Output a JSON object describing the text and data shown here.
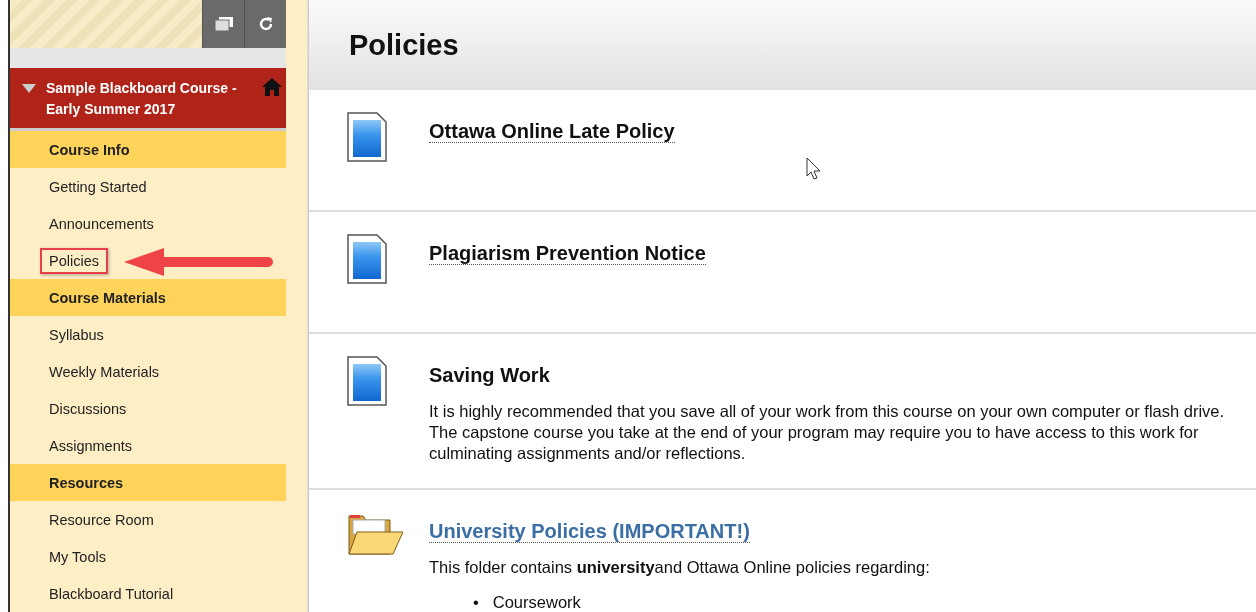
{
  "course": {
    "title": "Sample Blackboard Course - Early Summer 2017",
    "expanded": true
  },
  "menu": [
    {
      "kind": "header",
      "label": "Course Info",
      "highlighted": false
    },
    {
      "kind": "link",
      "label": "Getting Started",
      "highlighted": false
    },
    {
      "kind": "link",
      "label": "Announcements",
      "highlighted": false
    },
    {
      "kind": "link",
      "label": "Policies",
      "highlighted": true
    },
    {
      "kind": "header",
      "label": "Course Materials",
      "highlighted": false
    },
    {
      "kind": "link",
      "label": "Syllabus",
      "highlighted": false
    },
    {
      "kind": "link",
      "label": "Weekly Materials",
      "highlighted": false
    },
    {
      "kind": "link",
      "label": "Discussions",
      "highlighted": false
    },
    {
      "kind": "link",
      "label": "Assignments",
      "highlighted": false
    },
    {
      "kind": "header",
      "label": "Resources",
      "highlighted": false
    },
    {
      "kind": "link",
      "label": "Resource Room",
      "highlighted": false
    },
    {
      "kind": "link",
      "label": "My Tools",
      "highlighted": false
    },
    {
      "kind": "link",
      "label": "Blackboard Tutorial",
      "highlighted": false
    }
  ],
  "page": {
    "title": "Policies"
  },
  "items": [
    {
      "kind": "document",
      "title": "Ottawa Online Late Policy",
      "linked": true
    },
    {
      "kind": "document",
      "title": "Plagiarism Prevention Notice",
      "linked": true
    },
    {
      "kind": "document",
      "title": "Saving Work",
      "linked": false,
      "text": "It is highly recommended that you save all of your work from this course on your own computer or flash drive. The capstone course you take at the end of your program may require you to have access to this work for culminating assignments and/or reflections."
    },
    {
      "kind": "folder",
      "title": "University Policies (IMPORTANT!)",
      "linked": true,
      "text": "This folder contains **university**and Ottawa Online policies regarding:",
      "bullets": [
        {
          "marker": "•",
          "text": "Coursework"
        }
      ]
    }
  ]
}
